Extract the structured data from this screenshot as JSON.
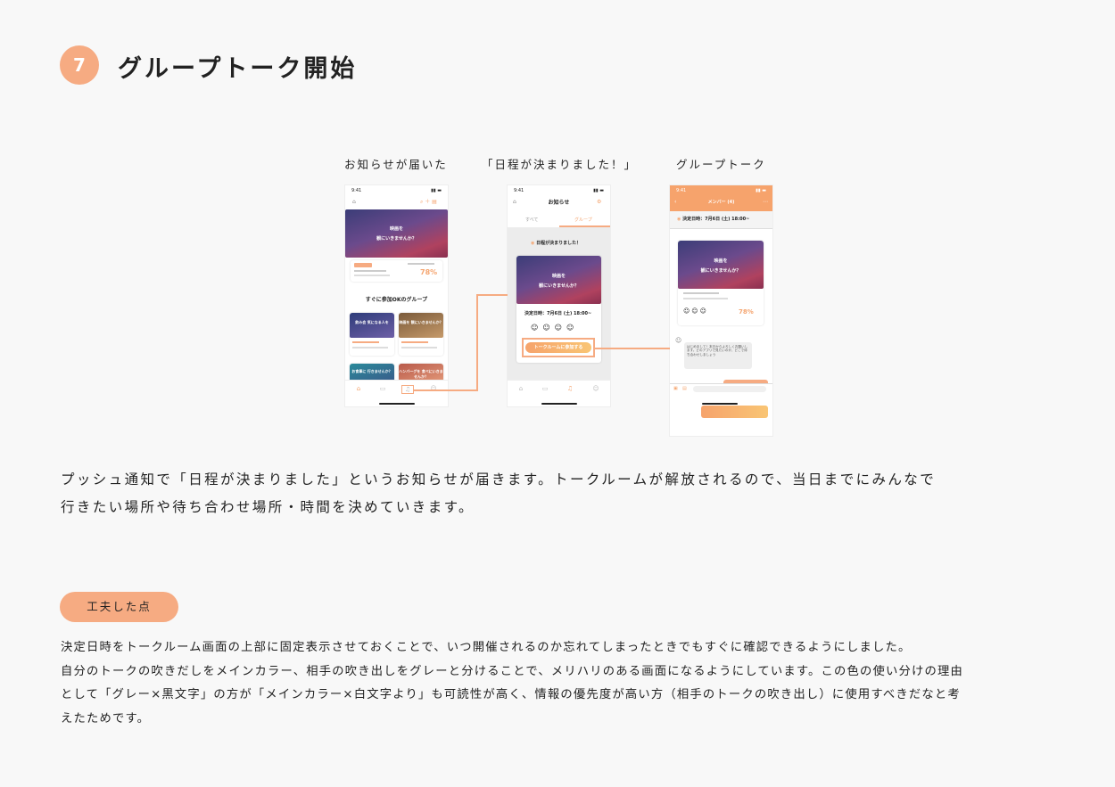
{
  "header": {
    "step_number": "7",
    "title": "グループトーク開始"
  },
  "screenshots": {
    "labels": [
      "お知らせが届いた",
      "「日程が決まりました！」",
      "グループトーク"
    ],
    "notification_feed": {
      "time": "9:41",
      "hero_text": [
        "映画を",
        "観にいきませんか？"
      ],
      "match_rate": "78%",
      "section_title": "すぐに参加OKのグループ",
      "tiles": [
        "飲み会 気になる人を",
        "映画を 観にいきませんか？",
        "お食事に 行きませんか？",
        "ハンバーグを 食べにいきませんか？"
      ]
    },
    "notice_detail": {
      "time": "9:41",
      "header_title": "お知らせ",
      "tabs": [
        "すべて",
        "グループ"
      ],
      "notice_title": "日程が決まりました！",
      "hero_text": [
        "映画を",
        "観にいきませんか？"
      ],
      "date_text": "決定日時：7月6日 (土) 18:00~",
      "button_label": "トークルームに参加する"
    },
    "group_talk": {
      "time": "9:41",
      "header_title": "メンバー (4)",
      "fixed_date": "決定日時：7月6日 (土) 18:00~",
      "hero_text": [
        "映画を",
        "観にいきませんか？"
      ],
      "match_rate": "78%",
      "message": "はじめまして！本日からよろしくお願いします。どのアプリで見たいのか、どこで待ち合わせしましょう"
    }
  },
  "description": [
    "プッシュ通知で「日程が決まりました」というお知らせが届きます。トークルームが解放されるので、当日までにみんなで",
    "行きたい場所や待ち合わせ場所・時間を決めていきます。"
  ],
  "point": {
    "label": "工夫した点",
    "lines": [
      "決定日時をトークルーム画面の上部に固定表示させておくことで、いつ開催されるのか忘れてしまったときでもすぐに確認できるようにしました。",
      "自分のトークの吹きだしをメインカラー、相手の吹き出しをグレーと分けることで、メリハリのある画面になるようにしています。この色の使い分けの理由",
      "として「グレー×黒文字」の方が「メインカラー×白文字より」も可読性が高く、情報の優先度が高い方（相手のトークの吹き出し）に使用すべきだなと考",
      "えたためです。"
    ]
  },
  "colors": {
    "accent": "#f6ab82",
    "background": "#f8f8f8",
    "text": "#222222"
  }
}
